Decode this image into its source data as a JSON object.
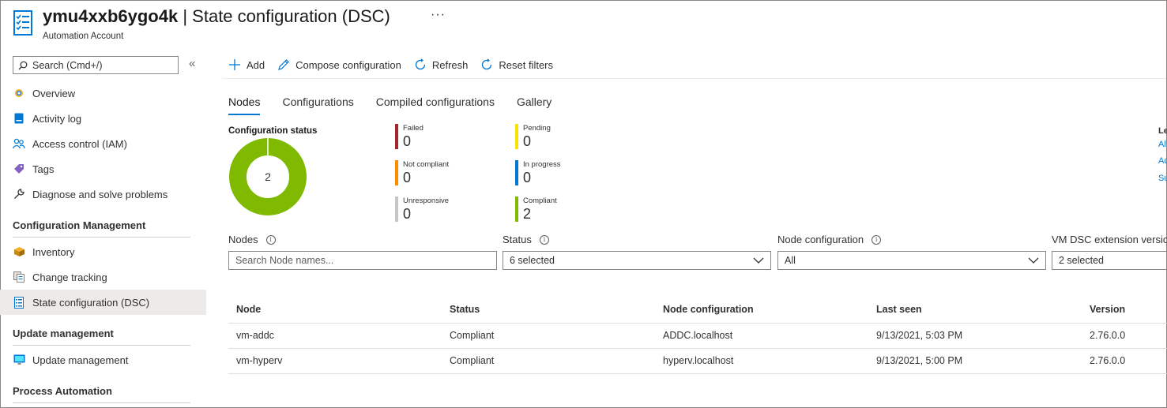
{
  "header": {
    "resource_name": "ymu4xxb6ygo4k",
    "separator": "|",
    "page_title": "State configuration (DSC)",
    "subtitle": "Automation Account",
    "more": "···"
  },
  "sidebar": {
    "search_placeholder": "Search (Cmd+/)",
    "collapse": "«",
    "items_top": [
      {
        "label": "Overview",
        "icon": "gear-icon"
      },
      {
        "label": "Activity log",
        "icon": "activity-log-icon"
      },
      {
        "label": "Access control (IAM)",
        "icon": "people-icon"
      },
      {
        "label": "Tags",
        "icon": "tag-icon"
      },
      {
        "label": "Diagnose and solve problems",
        "icon": "wrench-icon"
      }
    ],
    "section_config": "Configuration Management",
    "items_config": [
      {
        "label": "Inventory",
        "icon": "inventory-icon"
      },
      {
        "label": "Change tracking",
        "icon": "change-tracking-icon"
      },
      {
        "label": "State configuration (DSC)",
        "icon": "checklist-icon"
      }
    ],
    "section_update": "Update management",
    "items_update": [
      {
        "label": "Update management",
        "icon": "monitor-icon"
      }
    ],
    "section_process": "Process Automation"
  },
  "toolbar": {
    "add": "Add",
    "compose": "Compose configuration",
    "refresh": "Refresh",
    "reset": "Reset filters"
  },
  "tabs": [
    "Nodes",
    "Configurations",
    "Compiled configurations",
    "Gallery"
  ],
  "config_status": {
    "title": "Configuration status",
    "total": "2",
    "legend": [
      {
        "label": "Failed",
        "value": "0",
        "color": "#a4262c"
      },
      {
        "label": "Not compliant",
        "value": "0",
        "color": "#ff8c00"
      },
      {
        "label": "Unresponsive",
        "value": "0",
        "color": "#c8c6c4"
      },
      {
        "label": "Pending",
        "value": "0",
        "color": "#fce100"
      },
      {
        "label": "In progress",
        "value": "0",
        "color": "#0078d4"
      },
      {
        "label": "Compliant",
        "value": "2",
        "color": "#7fba00"
      }
    ],
    "right_cut": [
      "Le",
      "Al",
      "Ac",
      "Su"
    ]
  },
  "filters": {
    "nodes_label": "Nodes",
    "nodes_placeholder": "Search Node names...",
    "status_label": "Status",
    "status_value": "6 selected",
    "nodecfg_label": "Node configuration",
    "nodecfg_value": "All",
    "vmdsc_label": "VM DSC extension version",
    "vmdsc_value": "2 selected"
  },
  "table": {
    "headers": [
      "Node",
      "Status",
      "Node configuration",
      "Last seen",
      "Version"
    ],
    "rows": [
      [
        "vm-addc",
        "Compliant",
        "ADDC.localhost",
        "9/13/2021, 5:03 PM",
        "2.76.0.0"
      ],
      [
        "vm-hyperv",
        "Compliant",
        "hyperv.localhost",
        "9/13/2021, 5:00 PM",
        "2.76.0.0"
      ]
    ]
  }
}
